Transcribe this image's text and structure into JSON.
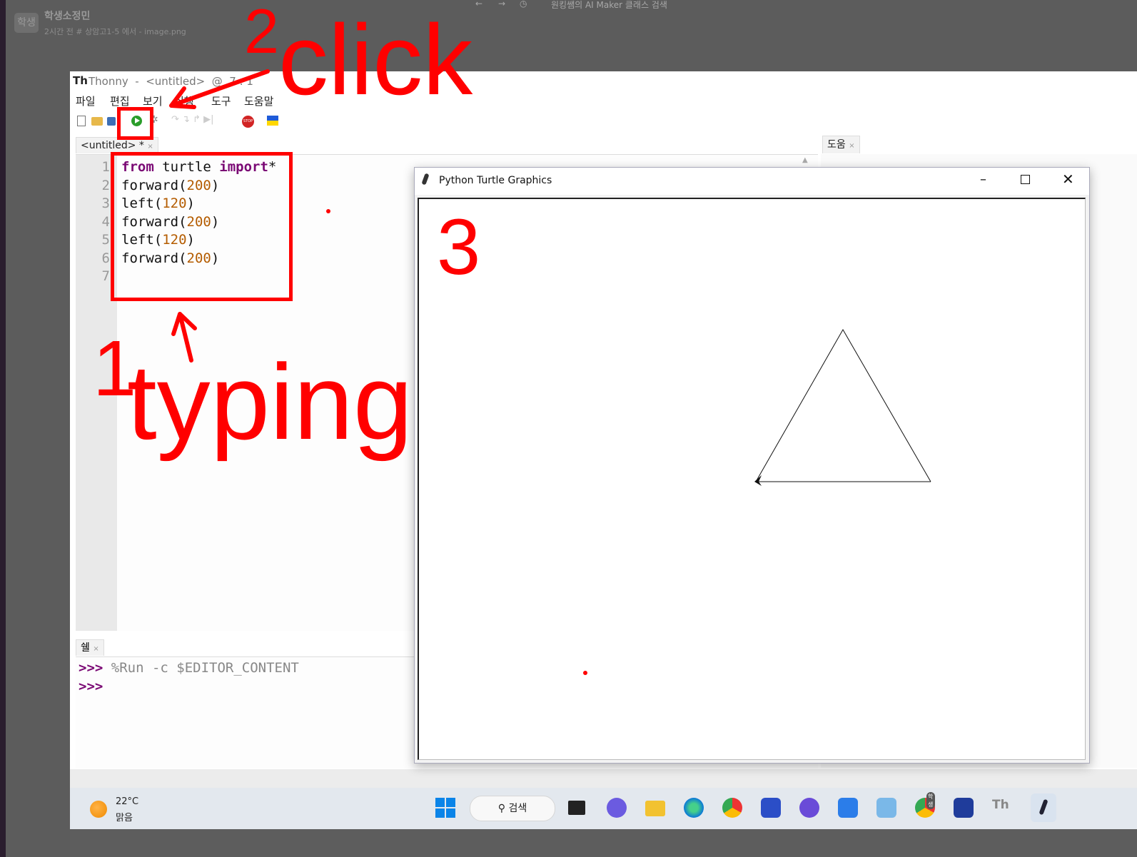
{
  "background_app": {
    "avatar": "학생",
    "name": "학생소정민",
    "meta": "2시간 전 # 상암고1-5 에서 - image.png",
    "top_search": "원킹쌤의 AI Maker 클래스 검색"
  },
  "thonny": {
    "title": "Thonny  -  <untitled>  @  7 : 1",
    "menu": [
      "파일",
      "편집",
      "보기",
      "실행",
      "도구",
      "도움말"
    ],
    "editor_tab": "<untitled> *",
    "help_tab": "도움",
    "code_lines": [
      {
        "n": "1",
        "parts": [
          {
            "t": "from",
            "c": "kw"
          },
          {
            "t": " turtle ",
            "c": ""
          },
          {
            "t": "import",
            "c": "kw"
          },
          {
            "t": "*",
            "c": ""
          }
        ]
      },
      {
        "n": "2",
        "parts": [
          {
            "t": "forward(",
            "c": ""
          },
          {
            "t": "200",
            "c": "num"
          },
          {
            "t": ")",
            "c": ""
          }
        ]
      },
      {
        "n": "3",
        "parts": [
          {
            "t": "left(",
            "c": ""
          },
          {
            "t": "120",
            "c": "num"
          },
          {
            "t": ")",
            "c": ""
          }
        ]
      },
      {
        "n": "4",
        "parts": [
          {
            "t": "forward(",
            "c": ""
          },
          {
            "t": "200",
            "c": "num"
          },
          {
            "t": ")",
            "c": ""
          }
        ]
      },
      {
        "n": "5",
        "parts": [
          {
            "t": "left(",
            "c": ""
          },
          {
            "t": "120",
            "c": "num"
          },
          {
            "t": ")",
            "c": ""
          }
        ]
      },
      {
        "n": "6",
        "parts": [
          {
            "t": "forward(",
            "c": ""
          },
          {
            "t": "200",
            "c": "num"
          },
          {
            "t": ")",
            "c": ""
          }
        ]
      },
      {
        "n": "7",
        "parts": []
      }
    ],
    "shell_tab": "쉘",
    "shell_prompt": ">>>",
    "shell_command": " %Run -c $EDITOR_CONTENT"
  },
  "turtle_window": {
    "title": "Python Turtle Graphics"
  },
  "annotations": {
    "step1": "1",
    "typing": "typing",
    "step2_click": "click",
    "step2_num": "2",
    "step3": "3",
    "color": "#ff0000"
  },
  "taskbar": {
    "temperature": "22°C",
    "weather": "맑음",
    "search_label": "검색",
    "chrome_badge": "학생"
  }
}
